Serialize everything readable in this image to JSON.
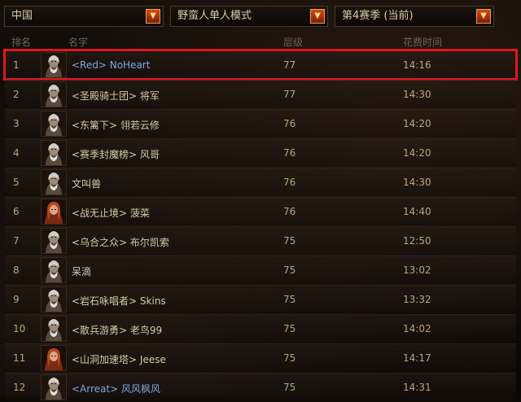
{
  "filters": {
    "region": "中国",
    "mode": "野蛮人单人模式",
    "season": "第4赛季 (当前)"
  },
  "columns": {
    "rank": "排名",
    "name": "名字",
    "level": "层级",
    "time": "花费时间"
  },
  "rows": [
    {
      "rank": "1",
      "name": "<Red> NoHeart",
      "level": "77",
      "time": "14:16",
      "portrait": "male"
    },
    {
      "rank": "2",
      "name": "<圣殿骑士团> 将军",
      "level": "77",
      "time": "14:30",
      "portrait": "male"
    },
    {
      "rank": "3",
      "name": "<东篱下> 翎若云修",
      "level": "76",
      "time": "14:20",
      "portrait": "male"
    },
    {
      "rank": "4",
      "name": "<赛季封魔榜> 风哥",
      "level": "76",
      "time": "14:20",
      "portrait": "male"
    },
    {
      "rank": "5",
      "name": "文叫兽",
      "level": "76",
      "time": "14:30",
      "portrait": "male"
    },
    {
      "rank": "6",
      "name": "<战无止境> 菠菜",
      "level": "76",
      "time": "14:40",
      "portrait": "female"
    },
    {
      "rank": "7",
      "name": "<乌合之众> 布尔凯索",
      "level": "75",
      "time": "12:50",
      "portrait": "male"
    },
    {
      "rank": "8",
      "name": "呆滴",
      "level": "75",
      "time": "13:02",
      "portrait": "male"
    },
    {
      "rank": "9",
      "name": "<岩石咏唱者> Skins",
      "level": "75",
      "time": "13:32",
      "portrait": "male"
    },
    {
      "rank": "10",
      "name": "<散兵游勇> 老鸟99",
      "level": "75",
      "time": "14:02",
      "portrait": "male"
    },
    {
      "rank": "11",
      "name": "<山洞加速塔> Jeese",
      "level": "75",
      "time": "14:17",
      "portrait": "female"
    },
    {
      "rank": "12",
      "name": "<Arreat> 风风枫风",
      "level": "75",
      "time": "14:31",
      "portrait": "male"
    }
  ],
  "highlight_color": "#e0161c",
  "accent_color": "#d84a0c"
}
